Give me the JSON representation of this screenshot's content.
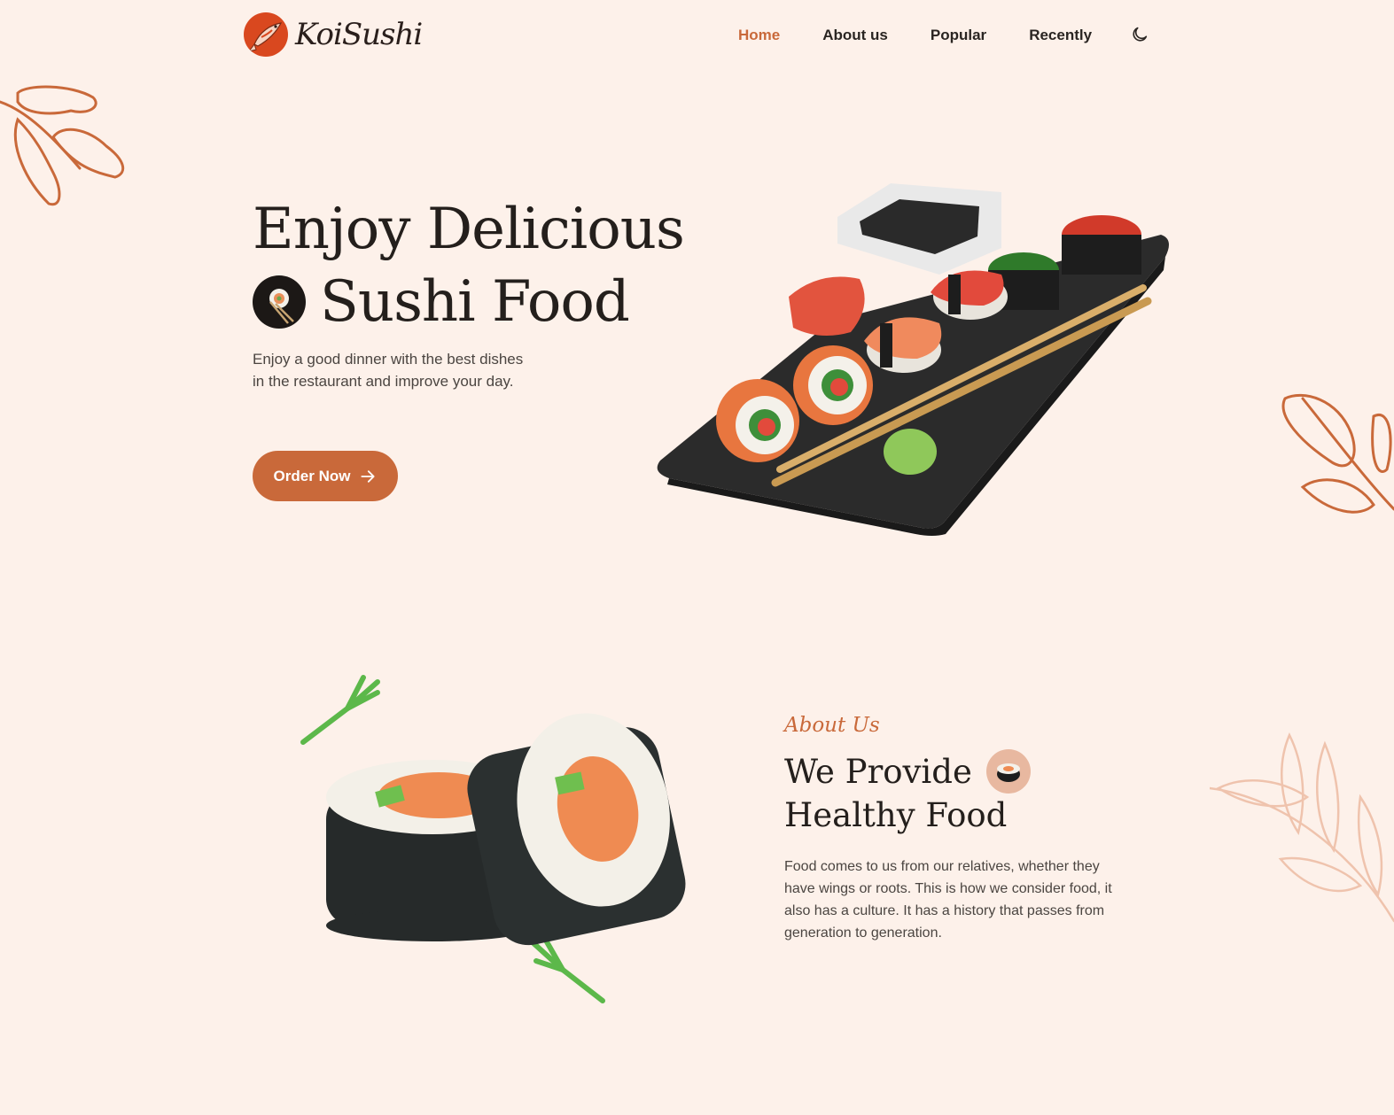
{
  "brand": {
    "name": "KoiSushi"
  },
  "nav": {
    "items": [
      {
        "label": "Home",
        "active": true
      },
      {
        "label": "About us",
        "active": false
      },
      {
        "label": "Popular",
        "active": false
      },
      {
        "label": "Recently",
        "active": false
      }
    ],
    "theme_icon": "moon-icon"
  },
  "hero": {
    "title_line1": "Enjoy Delicious",
    "title_line2": "Sushi Food",
    "description": "Enjoy a good dinner with the best dishes in the restaurant and improve your day.",
    "order_button": "Order Now",
    "order_button_icon": "arrow-right-icon"
  },
  "about": {
    "subtitle": "About Us",
    "title_line1": "We Provide",
    "title_line2": "Healthy Food",
    "description": "Food comes to us from our relatives, whether they have wings or roots. This is how we consider food, it also has a culture. It has a history that passes from generation to generation."
  },
  "colors": {
    "background": "#fdf1ea",
    "accent": "#c9693a",
    "text": "#241f1c",
    "logo": "#d9481f"
  }
}
